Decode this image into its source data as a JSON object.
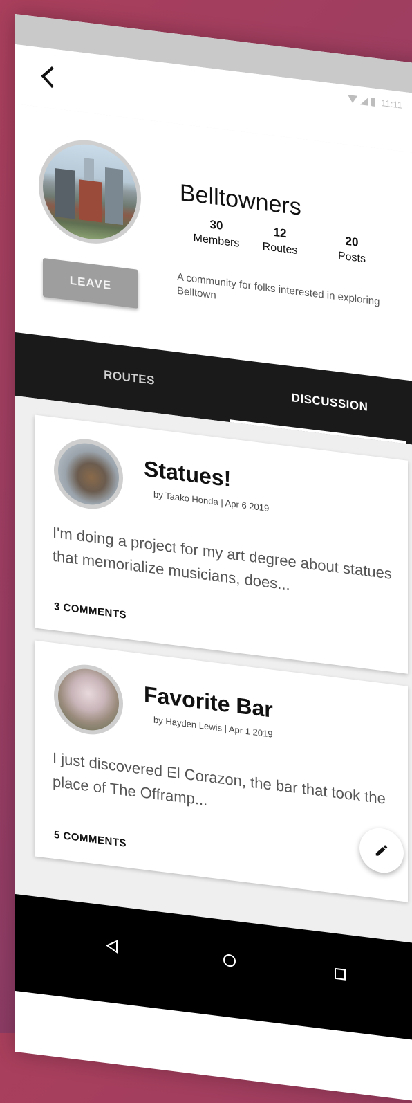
{
  "status_bar": {
    "time": "11:11"
  },
  "group": {
    "name": "Belltowners",
    "leave_label": "LEAVE",
    "stats": [
      {
        "value": "30",
        "label": "Members"
      },
      {
        "value": "12",
        "label": "Routes"
      },
      {
        "value": "20",
        "label": "Posts"
      }
    ],
    "description": "A community for folks interested in exploring Belltown"
  },
  "tabs": [
    {
      "label": "ROUTES",
      "active": false
    },
    {
      "label": "DISCUSSION",
      "active": true
    }
  ],
  "posts": [
    {
      "title": "Statues!",
      "byline": "by Taako Honda | Apr 6 2019",
      "body": "I'm doing a project for my art degree about statues that memorialize musicians, does...",
      "comments": "3 COMMENTS"
    },
    {
      "title": "Favorite Bar",
      "byline": "by Hayden Lewis | Apr 1 2019",
      "body": "I just discovered El Corazon, the bar that took the place of The Offramp...",
      "comments": "5 COMMENTS"
    }
  ],
  "fab": {
    "icon": "pencil-icon"
  },
  "nav": {
    "back_icon": "triangle-back-icon",
    "home_icon": "circle-home-icon",
    "recent_icon": "square-recents-icon"
  }
}
